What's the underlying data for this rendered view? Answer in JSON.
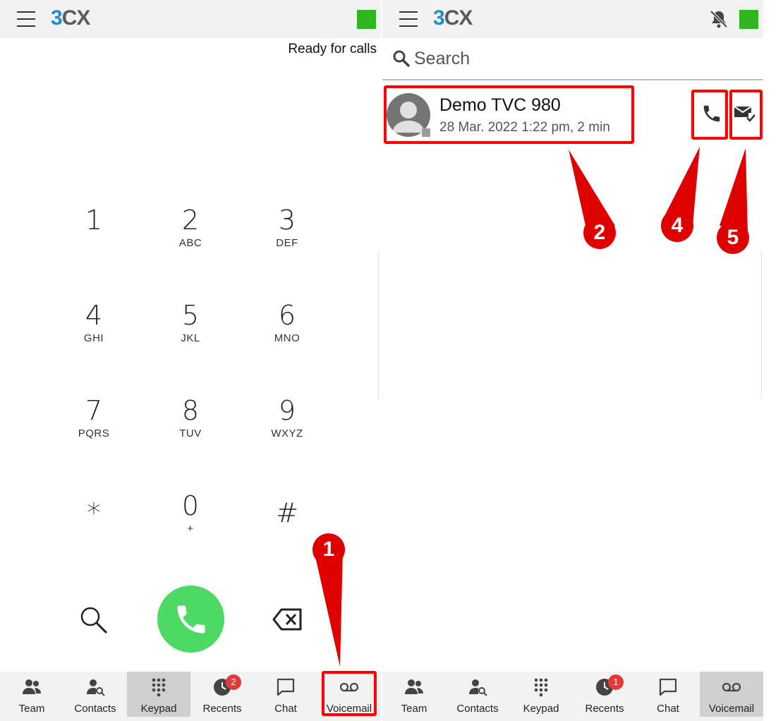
{
  "app": {
    "logo_part1": "3",
    "logo_part2": "CX",
    "brand_color": "#1b8fd1",
    "status_color": "#2fb51e"
  },
  "left_screen": {
    "status_text": "Ready for calls",
    "keypad": [
      {
        "digit": "1",
        "letters": ""
      },
      {
        "digit": "2",
        "letters": "ABC"
      },
      {
        "digit": "3",
        "letters": "DEF"
      },
      {
        "digit": "4",
        "letters": "GHI"
      },
      {
        "digit": "5",
        "letters": "JKL"
      },
      {
        "digit": "6",
        "letters": "MNO"
      },
      {
        "digit": "7",
        "letters": "PQRS"
      },
      {
        "digit": "8",
        "letters": "TUV"
      },
      {
        "digit": "9",
        "letters": "WXYZ"
      },
      {
        "digit": "*",
        "letters": ""
      },
      {
        "digit": "0",
        "letters": "+"
      },
      {
        "digit": "#",
        "letters": ""
      }
    ],
    "call_button_color": "#4cd964",
    "tabs": [
      {
        "label": "Team",
        "icon": "team-icon"
      },
      {
        "label": "Contacts",
        "icon": "contacts-icon"
      },
      {
        "label": "Keypad",
        "icon": "keypad-icon",
        "active": true
      },
      {
        "label": "Recents",
        "icon": "recents-icon",
        "badge": "2"
      },
      {
        "label": "Chat",
        "icon": "chat-icon"
      },
      {
        "label": "Voicemail",
        "icon": "voicemail-icon"
      }
    ]
  },
  "right_screen": {
    "search_placeholder": "Search",
    "voicemail": {
      "name": "Demo TVC 980",
      "meta": "28 Mar. 2022 1:22 pm,  2 min"
    },
    "tabs": [
      {
        "label": "Team",
        "icon": "team-icon"
      },
      {
        "label": "Contacts",
        "icon": "contacts-icon"
      },
      {
        "label": "Keypad",
        "icon": "keypad-icon"
      },
      {
        "label": "Recents",
        "icon": "recents-icon",
        "badge": "1"
      },
      {
        "label": "Chat",
        "icon": "chat-icon"
      },
      {
        "label": "Voicemail",
        "icon": "voicemail-icon",
        "active": true
      }
    ]
  },
  "annotations": {
    "color": "#e00000",
    "callouts": [
      "1",
      "2",
      "4",
      "5"
    ]
  }
}
